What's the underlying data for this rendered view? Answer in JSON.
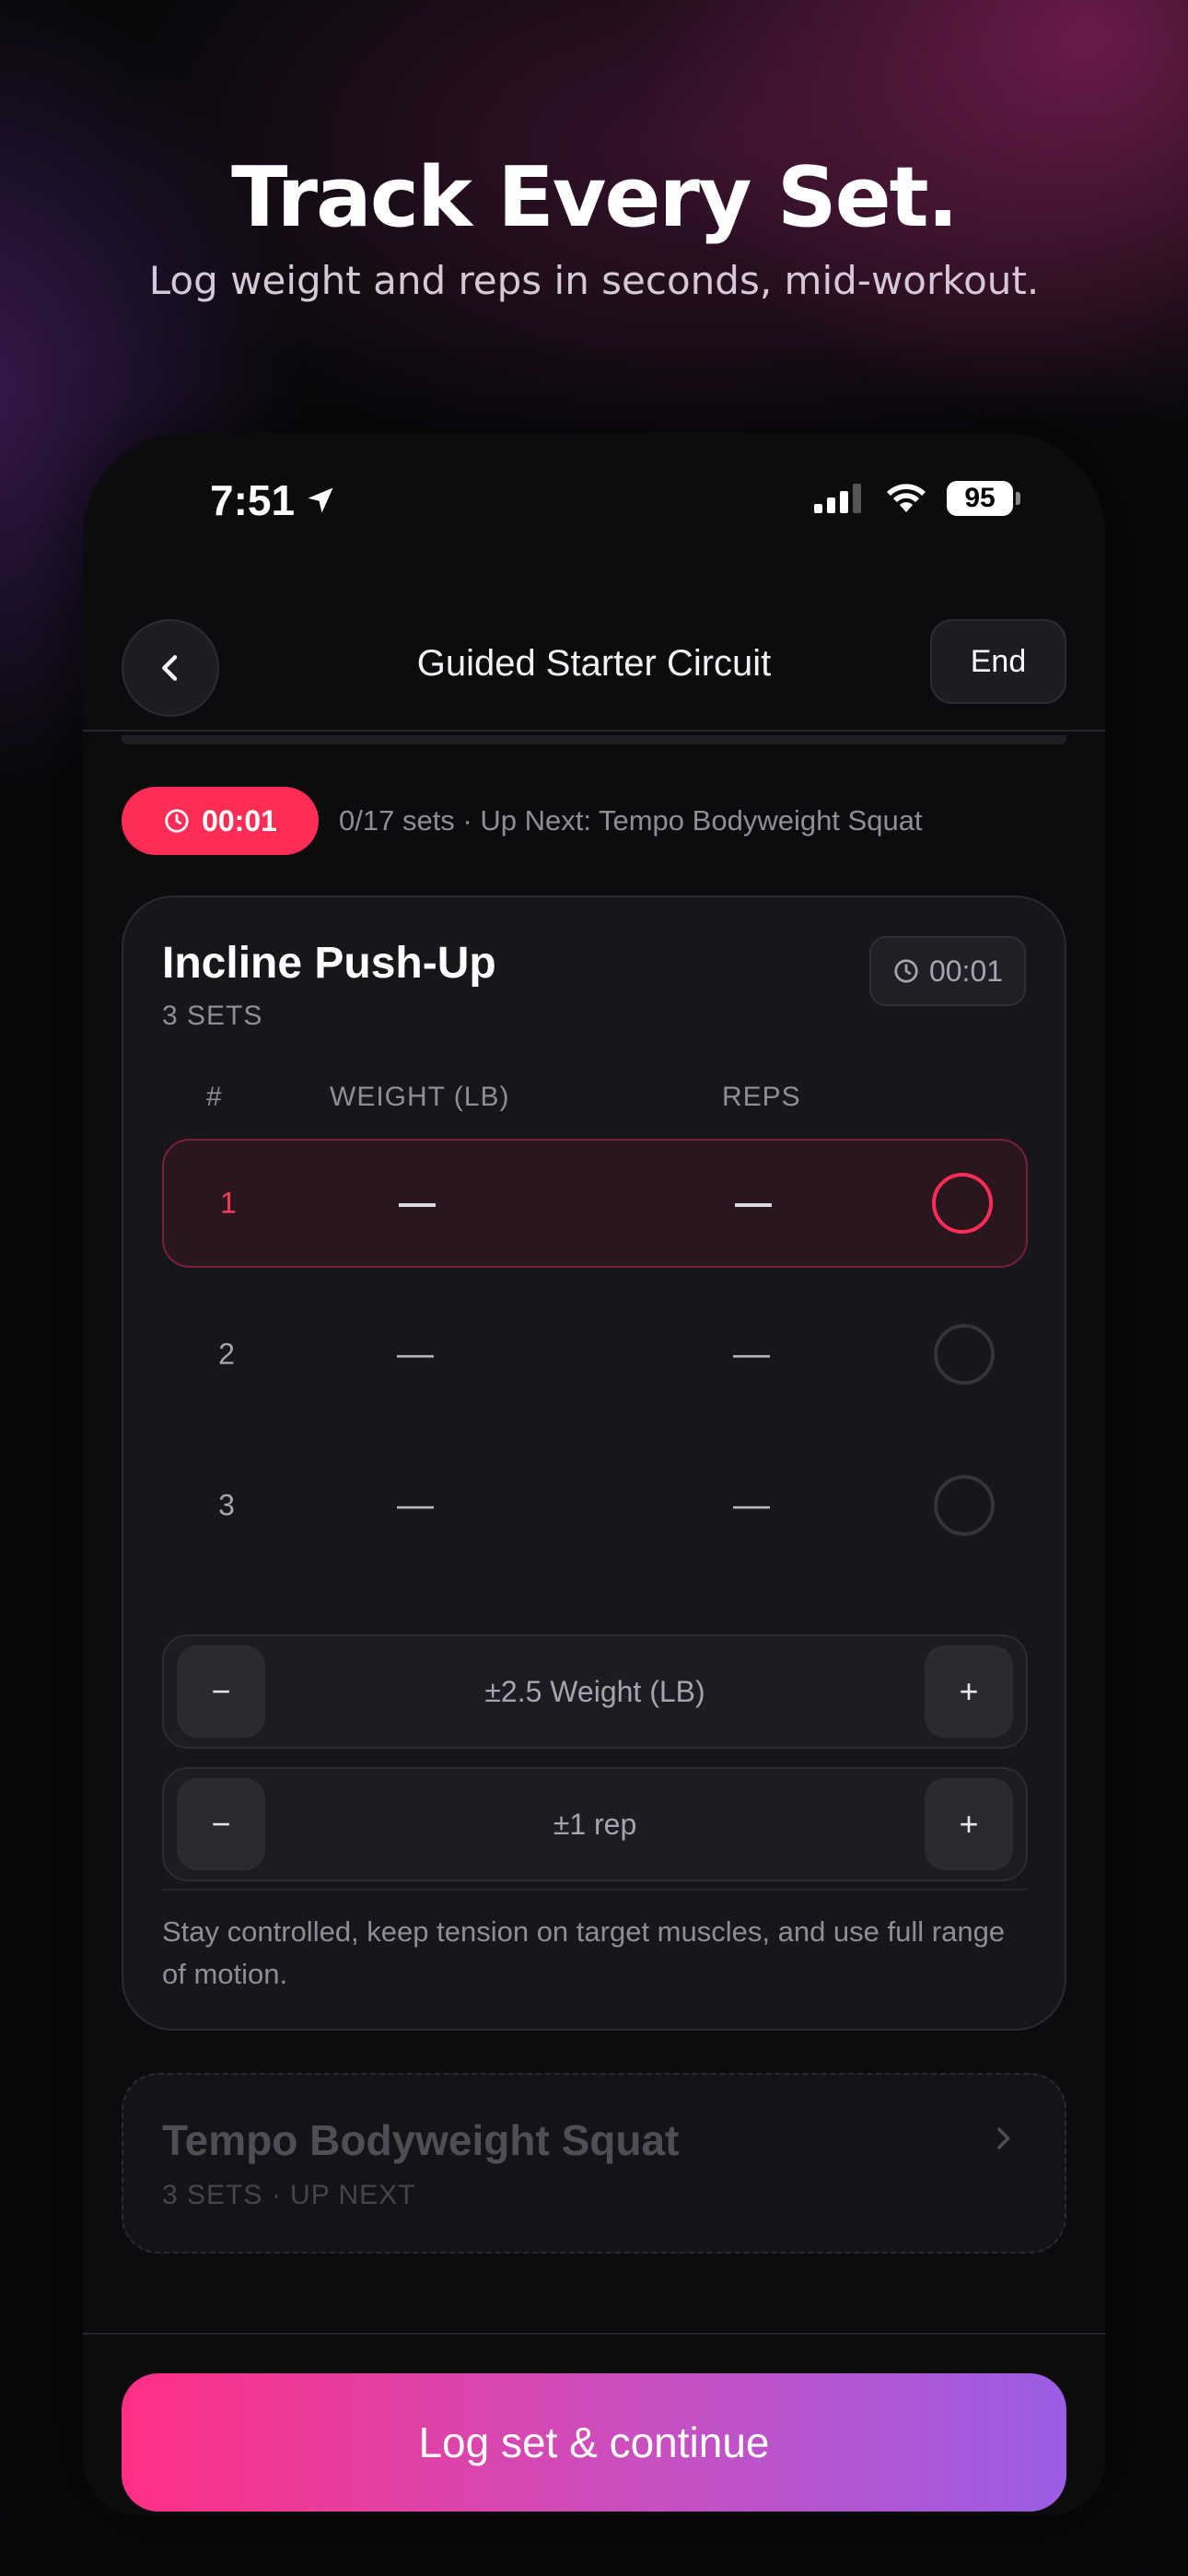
{
  "hero": {
    "title": "Track Every Set.",
    "subtitle": "Log weight and reps in seconds, mid-workout."
  },
  "status_bar": {
    "time": "7:51",
    "battery": "95",
    "icons": [
      "location-arrow-icon",
      "cellular-signal-icon",
      "wifi-icon",
      "battery-icon"
    ]
  },
  "nav": {
    "title": "Guided Starter Circuit",
    "end_label": "End"
  },
  "session": {
    "timer": "00:01",
    "info": "0/17 sets · Up Next: Tempo Bodyweight Squat",
    "progress": 0
  },
  "exercise": {
    "title": "Incline Push-Up",
    "sets_label": "3 SETS",
    "timer": "00:01",
    "columns": {
      "num": "#",
      "weight": "WEIGHT (LB)",
      "reps": "REPS"
    },
    "sets": [
      {
        "num": "1",
        "weight": "—",
        "reps": "—",
        "active": true
      },
      {
        "num": "2",
        "weight": "—",
        "reps": "—",
        "active": false
      },
      {
        "num": "3",
        "weight": "—",
        "reps": "—",
        "active": false
      }
    ],
    "weight_stepper": {
      "minus": "−",
      "label": "±2.5 Weight (LB)",
      "plus": "+"
    },
    "reps_stepper": {
      "minus": "−",
      "label": "±1 rep",
      "plus": "+"
    },
    "note": "Stay controlled, keep tension on target muscles, and use full range of motion."
  },
  "next_exercise": {
    "title": "Tempo Bodyweight Squat",
    "subtitle": "3 SETS · UP NEXT"
  },
  "cta": {
    "label": "Log set & continue"
  },
  "colors": {
    "accent": "#ff2d55",
    "cta_start": "#ff2f85",
    "cta_end": "#9b5de5",
    "background": "#09090c"
  }
}
